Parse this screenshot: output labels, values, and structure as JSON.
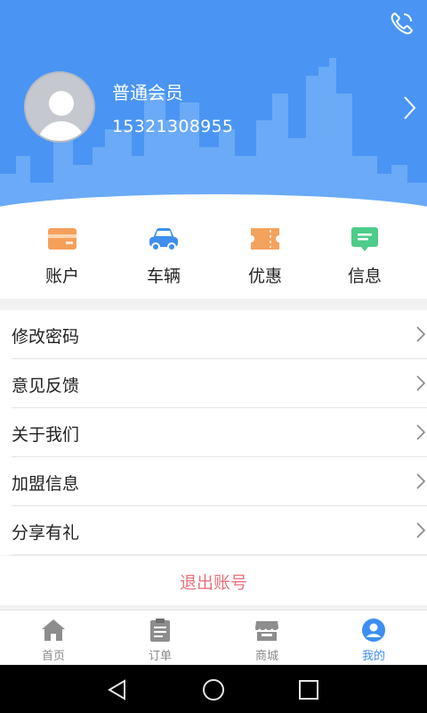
{
  "profile": {
    "member_level": "普通会员",
    "phone": "15321308955"
  },
  "quick_actions": [
    {
      "label": "账户",
      "icon": "card-icon",
      "color": "#f5a05a"
    },
    {
      "label": "车辆",
      "icon": "car-icon",
      "color": "#3f8ff0"
    },
    {
      "label": "优惠",
      "icon": "ticket-icon",
      "color": "#f4a35e"
    },
    {
      "label": "信息",
      "icon": "message-icon",
      "color": "#4dcc8a"
    }
  ],
  "menu": [
    {
      "label": "修改密码"
    },
    {
      "label": "意见反馈"
    },
    {
      "label": "关于我们"
    },
    {
      "label": "加盟信息"
    },
    {
      "label": "分享有礼"
    }
  ],
  "logout_label": "退出账号",
  "tabs": [
    {
      "label": "首页",
      "icon": "home-icon"
    },
    {
      "label": "订单",
      "icon": "clipboard-icon"
    },
    {
      "label": "商城",
      "icon": "store-icon"
    },
    {
      "label": "我的",
      "icon": "user-icon",
      "active": true
    }
  ],
  "colors": {
    "header": "#4a95f3",
    "accent": "#3c8ff0",
    "logout": "#e8707c"
  }
}
